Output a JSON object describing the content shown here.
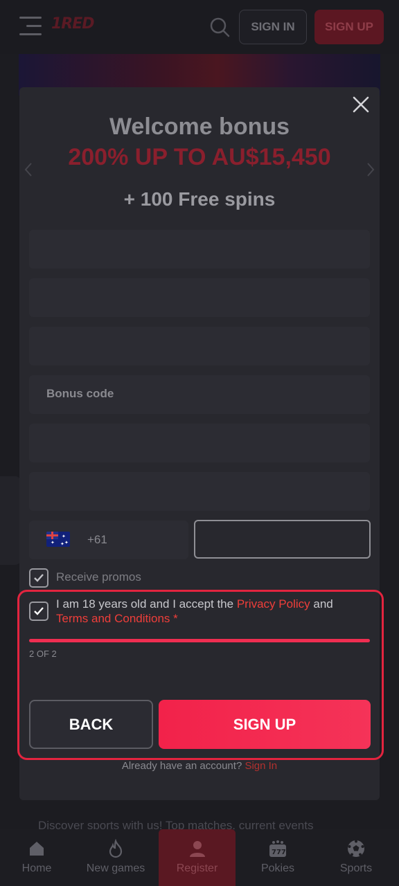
{
  "header": {
    "logo_text": "1RED",
    "signin_label": "SIGN IN",
    "signup_label": "SIGN UP"
  },
  "modal": {
    "title": "Welcome bonus",
    "offer": "200% UP TO AU$15,450",
    "spins": "+ 100 Free spins",
    "bonus_code_placeholder": "Bonus code",
    "phone": {
      "dial_code": "+61",
      "country_flag": "australia-flag",
      "value": ""
    },
    "promos_label": "Receive promos",
    "promos_checked": true,
    "terms": {
      "prefix": "I am 18 years old and I accept the ",
      "privacy_link": "Privacy Policy",
      "and": " and",
      "terms_link": "Terms and Conditions",
      "required_mark": " *",
      "checked": true
    },
    "progress": {
      "step_text": "2 OF 2",
      "fraction": 1.0
    },
    "back_label": "BACK",
    "signup_label": "SIGN UP",
    "already_text": "Already have an account? ",
    "signin_link": "Sign In"
  },
  "background": {
    "text": "Discover sports with us! Top matches, current events"
  },
  "bottom_nav": {
    "items": [
      {
        "label": "Home",
        "icon": "home-icon"
      },
      {
        "label": "New games",
        "icon": "flame-icon"
      },
      {
        "label": "Register",
        "icon": "user-icon"
      },
      {
        "label": "Pokies",
        "icon": "slot-machine-icon"
      },
      {
        "label": "Sports",
        "icon": "soccer-ball-icon"
      }
    ]
  },
  "colors": {
    "accent": "#f2224a",
    "highlight_border": "#e3243f",
    "link": "#ef3e3a"
  }
}
